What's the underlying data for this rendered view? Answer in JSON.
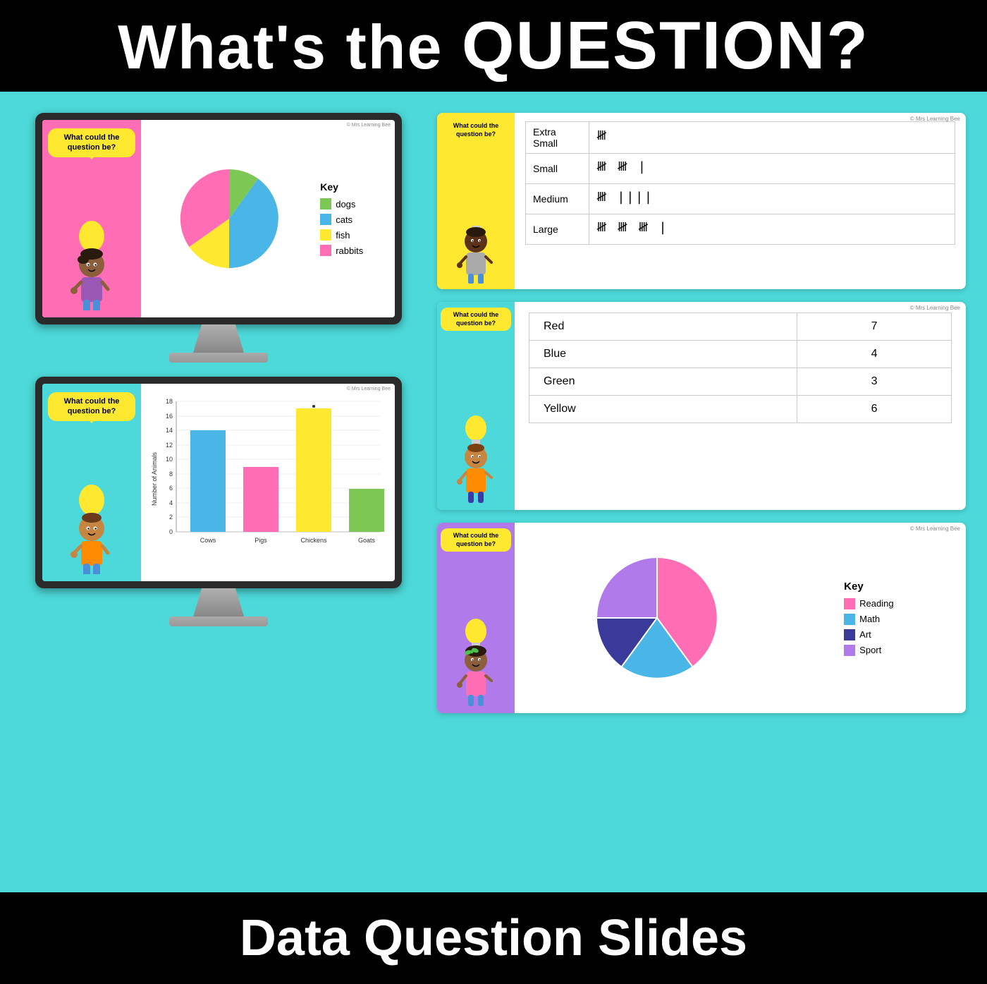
{
  "header": {
    "title_plain": "What's the ",
    "title_bold": "QUESTION?"
  },
  "footer": {
    "title": "Data Question Slides"
  },
  "monitor1": {
    "speech": "What could the question be?",
    "copyright": "© Mrs Learning Bee",
    "chart_title": "Key",
    "legend": [
      {
        "label": "dogs",
        "color": "#7dc855"
      },
      {
        "label": "cats",
        "color": "#4ab6e8"
      },
      {
        "label": "fish",
        "color": "#ffe930"
      },
      {
        "label": "rabbits",
        "color": "#ff6eb4"
      }
    ]
  },
  "monitor2": {
    "speech": "What could the question be?",
    "copyright": "© Mrs Learning Bee",
    "y_label": "Number of Animals",
    "bars": [
      {
        "label": "Cows",
        "value": 14,
        "color": "#4ab6e8"
      },
      {
        "label": "Pigs",
        "value": 9,
        "color": "#ff6eb4"
      },
      {
        "label": "Chickens",
        "value": 17,
        "color": "#ffe930"
      },
      {
        "label": "Goats",
        "value": 6,
        "color": "#7dc855"
      }
    ],
    "y_max": 18,
    "y_ticks": [
      0,
      2,
      4,
      6,
      8,
      10,
      12,
      14,
      16,
      18
    ]
  },
  "card1": {
    "speech": "What could the question be?",
    "copyright": "© Mrs Learning Bee",
    "rows": [
      {
        "label": "Extra Small",
        "tally": "𝍸"
      },
      {
        "label": "Small",
        "tally": "𝍸 𝍸 |"
      },
      {
        "label": "Medium",
        "tally": "𝍸 ||||"
      },
      {
        "label": "Large",
        "tally": "𝍸 𝍸 𝍸 |"
      }
    ]
  },
  "card2": {
    "speech": "What could the question be?",
    "copyright": "© Mrs Learning Bee",
    "rows": [
      {
        "label": "Red",
        "value": "7"
      },
      {
        "label": "Blue",
        "value": "4"
      },
      {
        "label": "Green",
        "value": "3"
      },
      {
        "label": "Yellow",
        "value": "6"
      }
    ]
  },
  "card3": {
    "speech": "What could the question be?",
    "copyright": "© Mrs Learning Bee",
    "chart_title": "Key",
    "legend": [
      {
        "label": "Reading",
        "color": "#ff6eb4"
      },
      {
        "label": "Math",
        "color": "#4ab6e8"
      },
      {
        "label": "Art",
        "color": "#3a3a9a"
      },
      {
        "label": "Sport",
        "color": "#b07aeb"
      }
    ]
  }
}
